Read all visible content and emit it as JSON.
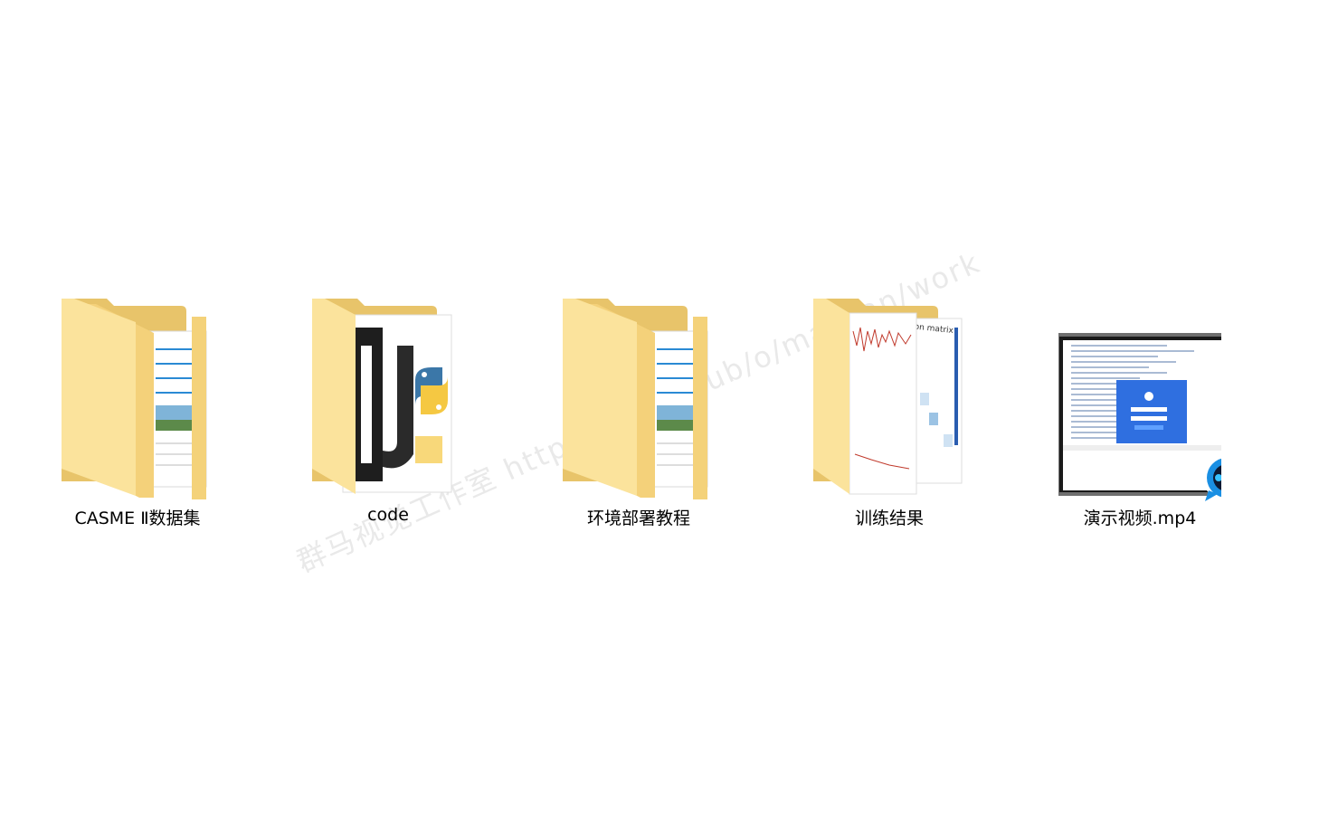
{
  "items": [
    {
      "name": "CASME Ⅱ数据集",
      "type": "folder",
      "preview": "document-image"
    },
    {
      "name": "code",
      "type": "folder",
      "preview": "code-logos"
    },
    {
      "name": "环境部署教程",
      "type": "folder",
      "preview": "document-image"
    },
    {
      "name": "训练结果",
      "type": "folder",
      "preview": "chart-matrix"
    },
    {
      "name": "演示视频.mp4",
      "type": "video",
      "preview": "film-strip"
    }
  ],
  "preview_text": {
    "confusion_title": "Confusion matrix"
  },
  "watermark": "群马视觉工作室 https://mbd.pub/o/mashan/work",
  "colors": {
    "folder_back": "#e8c46a",
    "folder_front": "#f8d776",
    "folder_front_light": "#fbe39c",
    "film": "#7a7a7a",
    "player_badge": "#1a8fe3",
    "screen_blue": "#2f6fe0"
  }
}
